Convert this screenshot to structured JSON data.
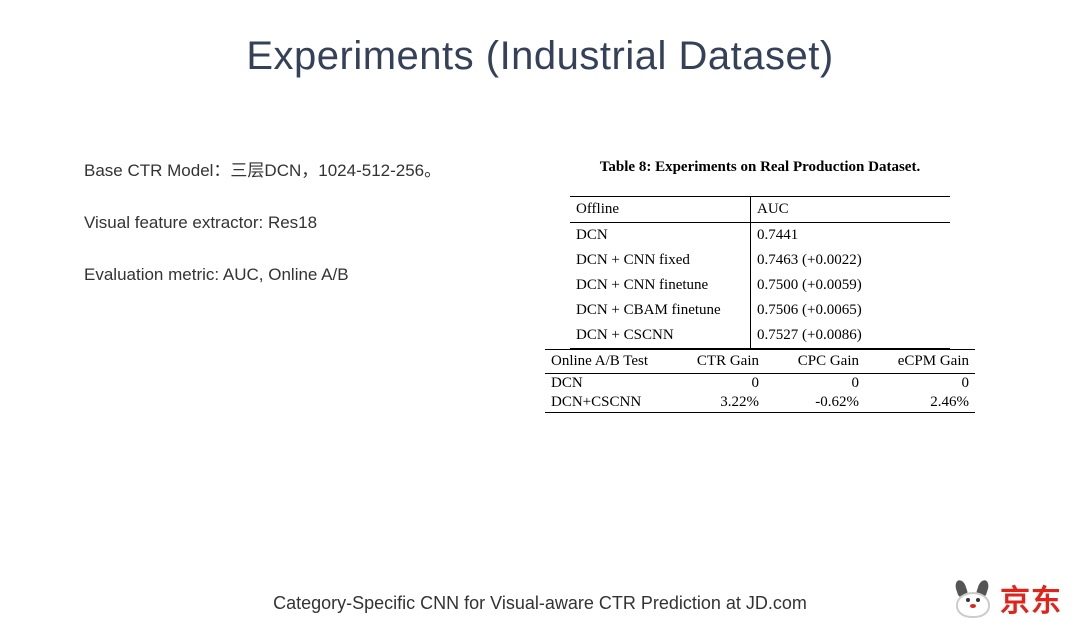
{
  "title": "Experiments (Industrial Dataset)",
  "bullets": {
    "b1": "Base CTR Model：三层DCN，1024-512-256。",
    "b2": "Visual feature extractor: Res18",
    "b3": "Evaluation metric: AUC, Online A/B"
  },
  "table": {
    "caption": "Table 8: Experiments on Real Production Dataset.",
    "offline": {
      "head_l": "Offline",
      "head_r": "AUC",
      "rows": [
        {
          "name": "DCN",
          "auc": "0.7441"
        },
        {
          "name": "DCN + CNN fixed",
          "auc": "0.7463 (+0.0022)"
        },
        {
          "name": "DCN + CNN finetune",
          "auc": "0.7500 (+0.0059)"
        },
        {
          "name": "DCN + CBAM finetune",
          "auc": "0.7506 (+0.0065)"
        },
        {
          "name": "DCN + CSCNN",
          "auc": "0.7527 (+0.0086)"
        }
      ]
    },
    "online": {
      "head": {
        "c1": "Online A/B Test",
        "c2": "CTR Gain",
        "c3": "CPC Gain",
        "c4": "eCPM Gain"
      },
      "rows": [
        {
          "c1": "DCN",
          "c2": "0",
          "c3": "0",
          "c4": "0"
        },
        {
          "c1": "DCN+CSCNN",
          "c2": "3.22%",
          "c3": "-0.62%",
          "c4": "2.46%"
        }
      ]
    }
  },
  "footer": "Category-Specific CNN for Visual-aware CTR Prediction at JD.com",
  "logo_text": "京东"
}
